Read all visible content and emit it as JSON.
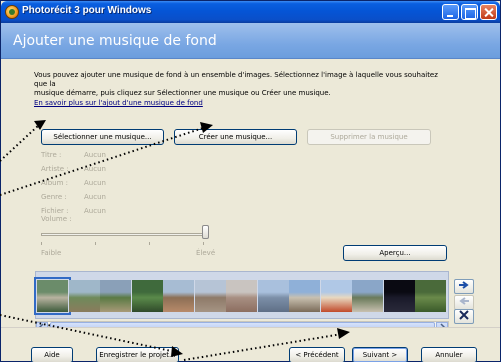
{
  "window": {
    "title": "Photorécit 3 pour Windows"
  },
  "header": {
    "title": "Ajouter une musique de fond"
  },
  "intro": {
    "line1": "Vous pouvez ajouter une musique de fond à un ensemble d'images. Sélectionnez l'image à laquelle vous souhaitez que la",
    "line2": "musique démarre, puis cliquez sur Sélectionner une musique ou Créer une musique.",
    "learn_more_link": "En savoir plus sur l'ajout d'une musique de fond"
  },
  "music_buttons": {
    "select": "Sélectionner une musique...",
    "create": "Créer une musique...",
    "remove": "Supprimer la musique"
  },
  "music_info": [
    {
      "label": "Titre :",
      "value": "Aucun"
    },
    {
      "label": "Artiste :",
      "value": "Aucun"
    },
    {
      "label": "Album :",
      "value": "Aucun"
    },
    {
      "label": "Genre :",
      "value": "Aucun"
    },
    {
      "label": "Fichier :",
      "value": "Aucun"
    },
    {
      "label": "Volume :",
      "value": ""
    }
  ],
  "volume": {
    "low_label": "Faible",
    "high_label": "Élevé",
    "level": 1.0
  },
  "preview_button": "Aperçu...",
  "filmstrip": {
    "selected_index": 0,
    "thumbnails": [
      {
        "name": "thumb-1",
        "colors": [
          "#6b8c6a",
          "#b8b3a0",
          "#3c5a3a"
        ]
      },
      {
        "name": "thumb-2",
        "colors": [
          "#9fb7c9",
          "#6f8a5b",
          "#8a7c5c"
        ]
      },
      {
        "name": "thumb-3",
        "colors": [
          "#8aa0b8",
          "#5a7a44",
          "#a89a78"
        ]
      },
      {
        "name": "thumb-4",
        "colors": [
          "#3f6a3c",
          "#5a8a4a",
          "#2f4a2a"
        ]
      },
      {
        "name": "thumb-5",
        "colors": [
          "#a7bcd3",
          "#8c6f55",
          "#b88a6a"
        ]
      },
      {
        "name": "thumb-6",
        "colors": [
          "#b6c4d6",
          "#8e7a68",
          "#a59484"
        ]
      },
      {
        "name": "thumb-7",
        "colors": [
          "#c9c4c0",
          "#a88f82",
          "#8c6e60"
        ]
      },
      {
        "name": "thumb-8",
        "colors": [
          "#a9c0dd",
          "#7c8fa8",
          "#5f6f86"
        ]
      },
      {
        "name": "thumb-9",
        "colors": [
          "#8fb0d8",
          "#c8c0b0",
          "#7a6a58"
        ]
      },
      {
        "name": "thumb-10",
        "colors": [
          "#b0c8e6",
          "#e8d8c0",
          "#c14a2a"
        ]
      },
      {
        "name": "thumb-11",
        "colors": [
          "#8aa6c8",
          "#6a7a5a",
          "#c8c0b0"
        ]
      },
      {
        "name": "thumb-12",
        "colors": [
          "#0a0a12",
          "#1a1a2a",
          "#2a2a3a"
        ]
      },
      {
        "name": "thumb-13",
        "colors": [
          "#4a6a3a",
          "#6a8a4a",
          "#3a5a2a"
        ]
      }
    ]
  },
  "footer": {
    "help": "Aide",
    "save_project": "Enregistrer le projet...",
    "previous": "< Précédent",
    "next": "Suivant >",
    "cancel": "Annuler"
  },
  "colors": {
    "titlebar": "#0555d6",
    "header": "#7aa7e3",
    "face": "#ece9d8",
    "annotation": "#000000"
  }
}
